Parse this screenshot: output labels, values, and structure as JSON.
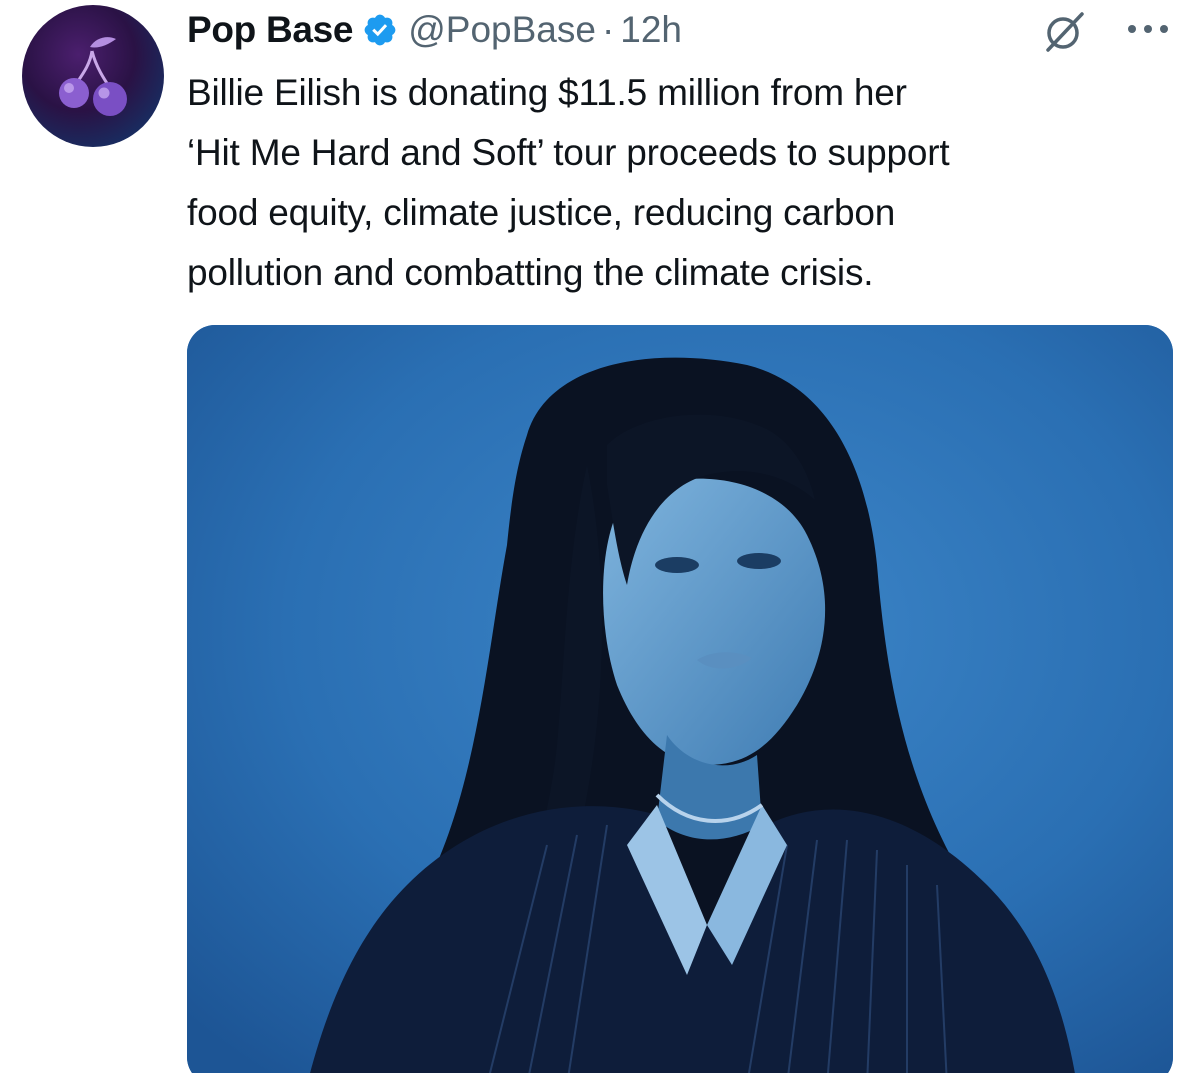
{
  "author": {
    "display_name": "Pop Base",
    "handle": "@PopBase",
    "separator": "·",
    "timestamp": "12h",
    "verified": true,
    "avatar_icon": "cherries-icon",
    "verified_color": "#1d9bf0"
  },
  "actions": {
    "grok_icon": "slashed-circle-icon",
    "more_icon": "ellipsis-icon"
  },
  "tweet": {
    "lines": [
      "Billie Eilish is donating $11.5 million from her",
      "‘Hit Me Hard and Soft’ tour proceeds to support",
      "food equity, climate justice, reducing carbon",
      "pollution and combatting the climate crisis."
    ]
  },
  "media": {
    "type": "photo",
    "dominant_color": "#2a6fb3"
  }
}
